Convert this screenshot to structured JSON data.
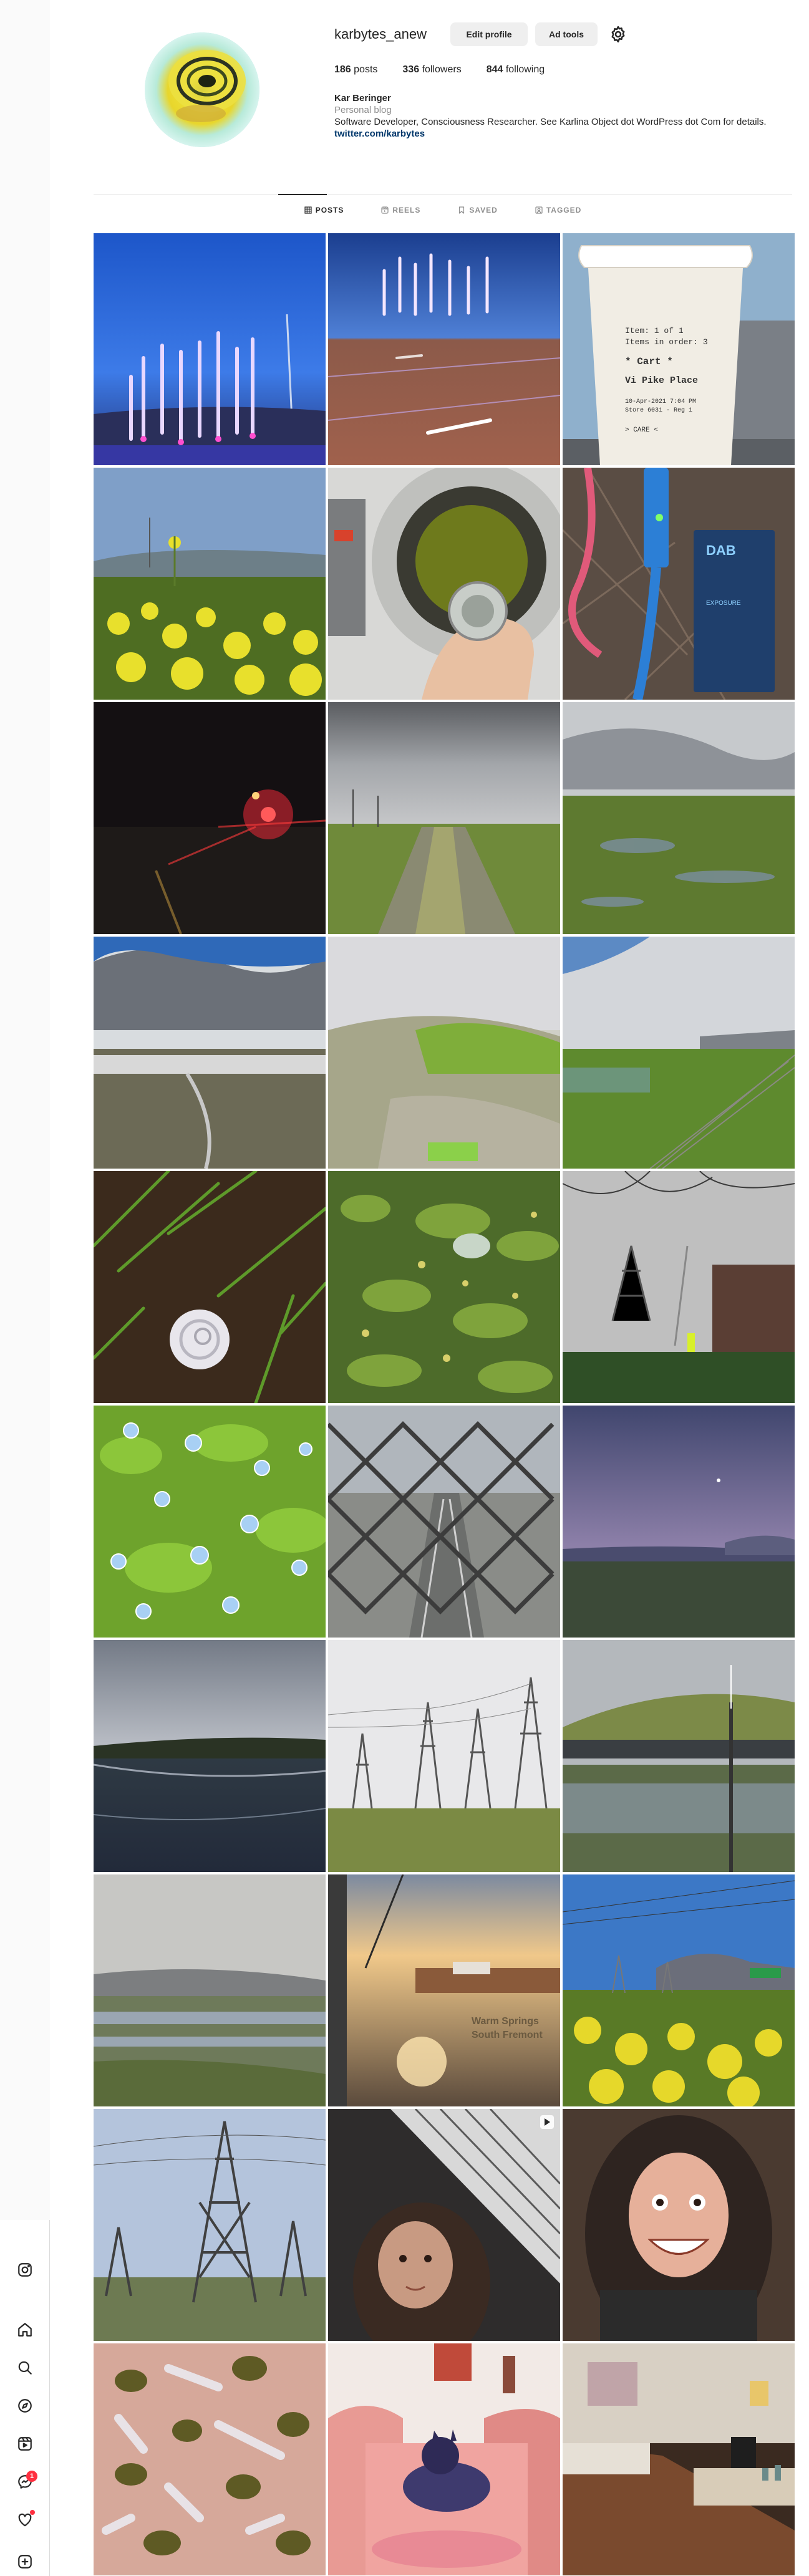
{
  "profile": {
    "username": "karbytes_anew",
    "edit_profile_label": "Edit profile",
    "ad_tools_label": "Ad tools",
    "stats": {
      "posts_count": "186",
      "posts_label": "posts",
      "followers_count": "336",
      "followers_label": "followers",
      "following_count": "844",
      "following_label": "following"
    },
    "bio": {
      "name": "Kar Beringer",
      "category": "Personal blog",
      "text": "Software Developer, Consciousness Researcher. See Karlina Object dot WordPress dot Com for details.",
      "link": "twitter.com/karbytes"
    }
  },
  "tabs": [
    {
      "label": "POSTS",
      "icon": "grid-icon",
      "active": true
    },
    {
      "label": "REELS",
      "icon": "reels-icon",
      "active": false
    },
    {
      "label": "SAVED",
      "icon": "bookmark-icon",
      "active": false
    },
    {
      "label": "TAGGED",
      "icon": "tag-icon",
      "active": false
    }
  ],
  "nav": {
    "items": [
      "instagram-logo-icon",
      "home-icon",
      "search-icon",
      "explore-icon",
      "reels-icon",
      "messenger-icon",
      "heart-icon",
      "create-icon"
    ],
    "messages_badge": "1"
  },
  "posts": [
    {
      "scene": "light-poles-blue-dusk"
    },
    {
      "scene": "light-poles-plaza"
    },
    {
      "scene": "coffee-cup-label"
    },
    {
      "scene": "mustard-flowers-field"
    },
    {
      "scene": "washing-machine-hand"
    },
    {
      "scene": "cables-and-box"
    },
    {
      "scene": "night-red-lights"
    },
    {
      "scene": "gravel-path-marsh"
    },
    {
      "scene": "marsh-cloudy"
    },
    {
      "scene": "marsh-clouds-road"
    },
    {
      "scene": "grass-dune"
    },
    {
      "scene": "marsh-fence"
    },
    {
      "scene": "snail-shell"
    },
    {
      "scene": "weeds-closeup"
    },
    {
      "scene": "tower-and-fence"
    },
    {
      "scene": "blue-flowers"
    },
    {
      "scene": "chainlink-freeway"
    },
    {
      "scene": "dusk-hills"
    },
    {
      "scene": "reflective-water"
    },
    {
      "scene": "power-towers-field"
    },
    {
      "scene": "flooded-marsh-hill"
    },
    {
      "scene": "marsh-water-mountains"
    },
    {
      "scene": "sunset-station-sign"
    },
    {
      "scene": "yellow-flowers-towers"
    },
    {
      "scene": "power-tower-closeup"
    },
    {
      "scene": "selfie-stairs"
    },
    {
      "scene": "selfie-smile"
    },
    {
      "scene": "craft-clay-pieces"
    },
    {
      "scene": "cat-on-pink-couch"
    },
    {
      "scene": "room-desk"
    }
  ],
  "image_captions": {
    "coffee_cup": [
      "Item: 1 of 1",
      "Items in order: 3",
      "* Cart *",
      "Vi Pike Place",
      "10-Apr-2021  7:04 PM",
      "Store 6031 - Reg 1",
      "> CARE <"
    ],
    "station_sign": [
      "Warm Springs",
      "South Fremont"
    ],
    "box_label": [
      "DAB",
      "EXPOSURE"
    ]
  },
  "colors": {
    "accent_link": "#00376b",
    "badge_red": "#ff3040",
    "button_bg": "#efefef",
    "muted_text": "#8e8e8e"
  }
}
